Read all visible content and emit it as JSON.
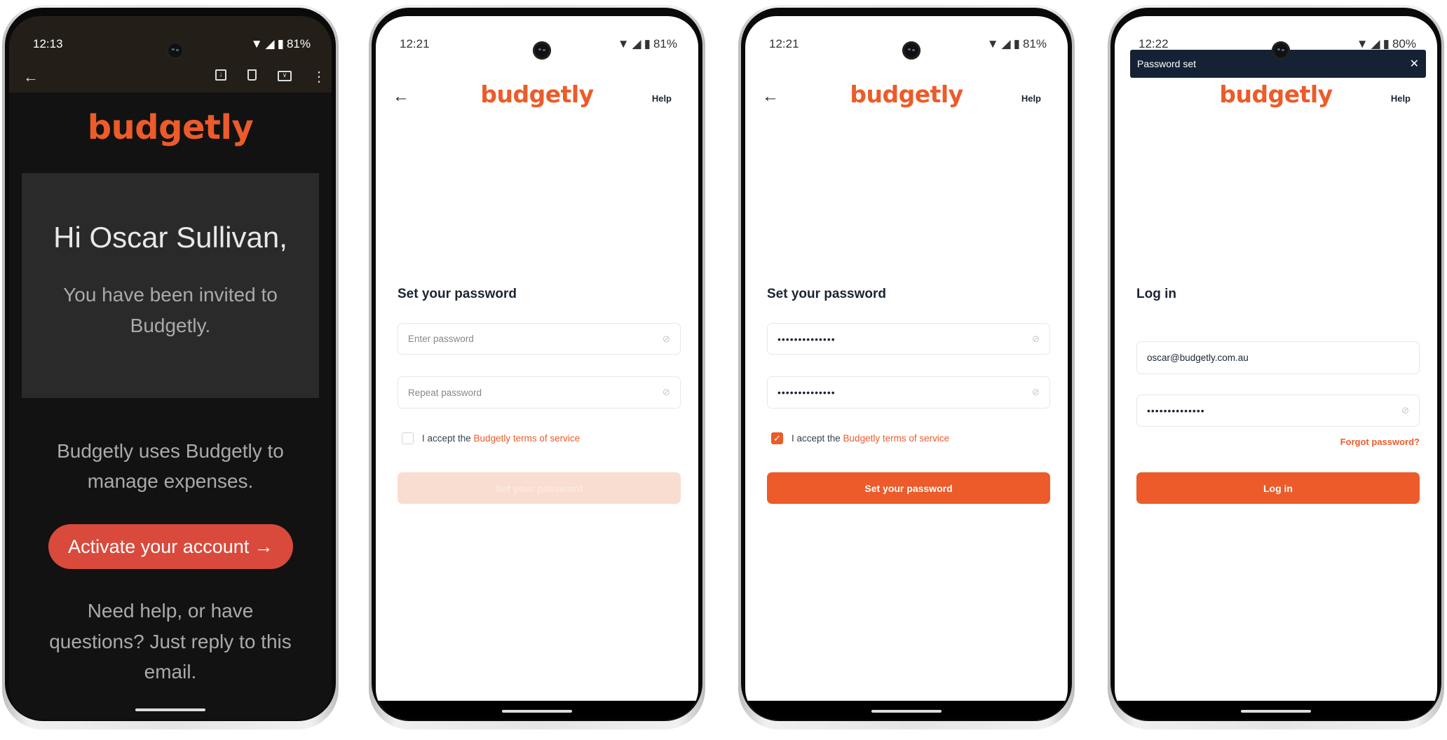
{
  "colors": {
    "brand": "#ec5b29",
    "toast_bg": "#152236",
    "email_button": "#d94a3c"
  },
  "logo_text": "budgetly",
  "email_screen": {
    "status": {
      "time": "12:13",
      "battery": "81%"
    },
    "toolbar_icons": [
      "back-arrow-icon",
      "archive-icon",
      "delete-icon",
      "mark-unread-icon",
      "more-vert-icon"
    ],
    "greeting": "Hi Oscar Sullivan,",
    "invite_lines": [
      "You have been invited to",
      "Budgetly."
    ],
    "body_lines": [
      "Budgetly uses Budgetly to",
      "manage expenses."
    ],
    "cta": "Activate your account →",
    "help_lines": [
      "Need help, or have",
      "questions? Just reply to this",
      "email."
    ]
  },
  "set_password_empty": {
    "status": {
      "time": "12:21",
      "battery": "81%"
    },
    "help": "Help",
    "title": "Set your password",
    "password_placeholder": "Enter password",
    "repeat_placeholder": "Repeat password",
    "accept_prefix": "I accept the ",
    "terms_link": "Budgetly terms of service",
    "terms_checked": false,
    "submit": "Set your password"
  },
  "set_password_filled": {
    "status": {
      "time": "12:21",
      "battery": "81%"
    },
    "help": "Help",
    "title": "Set your password",
    "password_value": "••••••••••••••",
    "repeat_value": "••••••••••••••",
    "accept_prefix": "I accept the ",
    "terms_link": "Budgetly terms of service",
    "terms_checked": true,
    "submit": "Set your password"
  },
  "login": {
    "status": {
      "time": "12:22",
      "battery": "80%"
    },
    "toast": "Password set",
    "help": "Help",
    "title": "Log in",
    "email_value": "oscar@budgetly.com.au",
    "password_value": "••••••••••••••",
    "forgot": "Forgot password?",
    "submit": "Log in"
  }
}
